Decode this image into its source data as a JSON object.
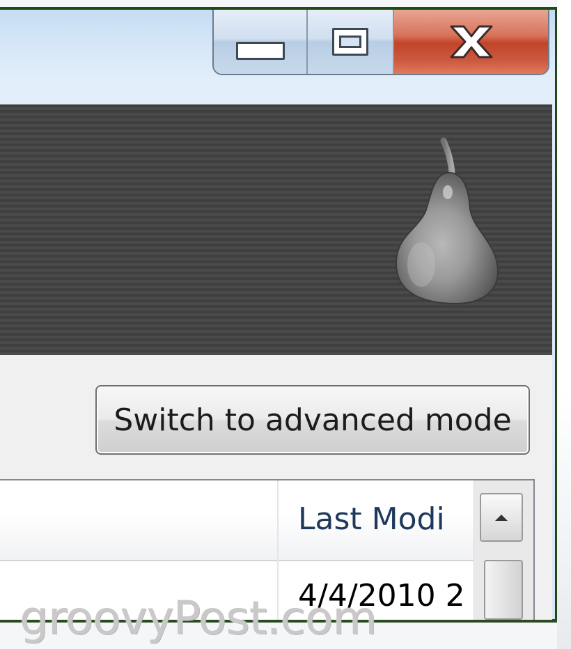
{
  "window": {
    "controls": {
      "minimize_icon": "minimize-icon",
      "maximize_icon": "maximize-icon",
      "close_icon": "close-icon",
      "close_color": "#c94a2c"
    }
  },
  "banner": {
    "background": "#444444",
    "logo_icon": "pear-icon"
  },
  "actions": {
    "switch_mode_label": "Switch to advanced mode"
  },
  "file_list": {
    "columns": [
      {
        "label": ""
      },
      {
        "label": "Last Modi"
      }
    ],
    "rows": [
      {
        "name": "",
        "last_modified": "4/4/2010 2"
      }
    ]
  },
  "watermark": "groovyPost.com"
}
